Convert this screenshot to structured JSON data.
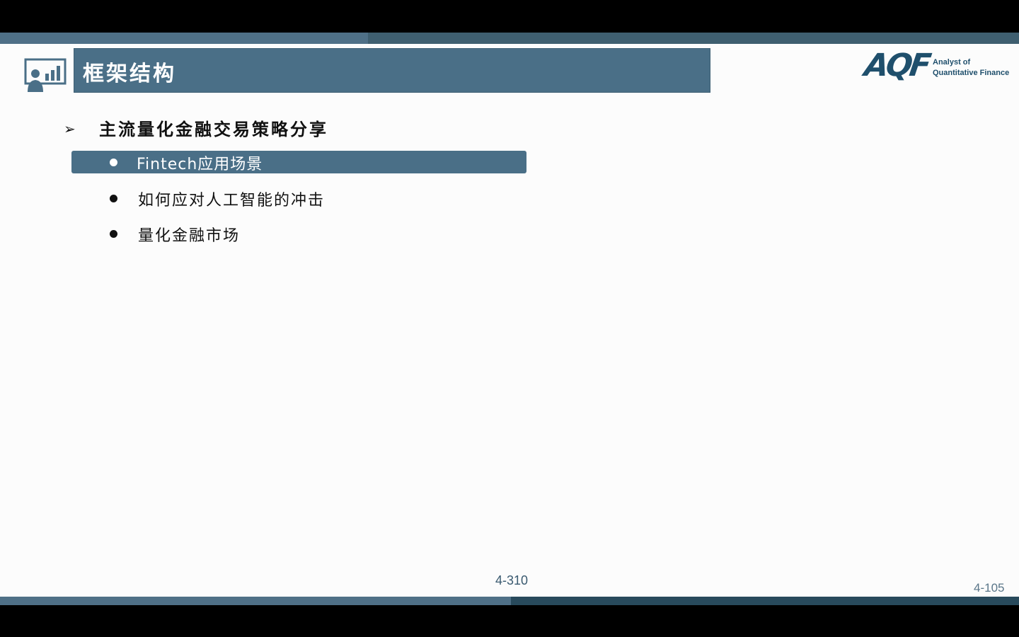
{
  "title": "框架结构",
  "logo": {
    "mark": "AQF",
    "line1": "Analyst of",
    "line2": "Quantitative Finance"
  },
  "section": {
    "arrow_icon": "arrow-bullet-icon",
    "title": "主流量化金融交易策略分享"
  },
  "items": [
    {
      "label": "Fintech应用场景",
      "active": true
    },
    {
      "label": "如何应对人工智能的冲击",
      "active": false
    },
    {
      "label": "量化金融市场",
      "active": false
    }
  ],
  "page_numbers": {
    "center": "4-310",
    "right": "4-105"
  },
  "colors": {
    "accent": "#4a6f87",
    "stripe_dark": "#284a5c",
    "logo": "#1f4f6c"
  }
}
